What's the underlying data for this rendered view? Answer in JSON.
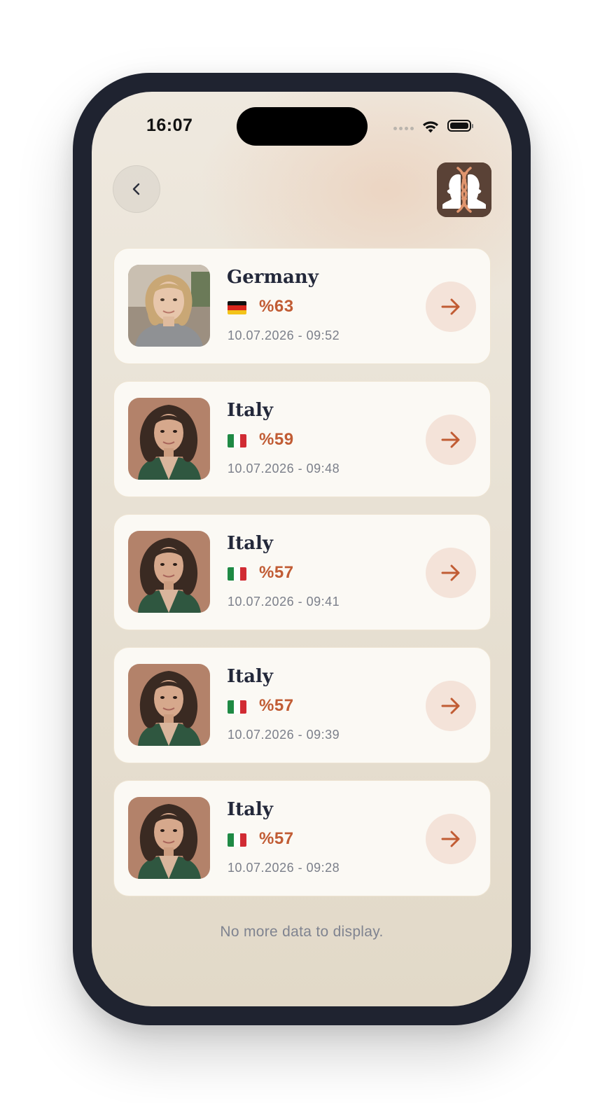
{
  "status_bar": {
    "time": "16:07",
    "signal_icon": "cellular-signal-icon",
    "wifi_icon": "wifi-icon",
    "battery_icon": "battery-icon"
  },
  "header": {
    "back_icon": "chevron-left-icon",
    "logo_icon": "dna-faces-logo-icon"
  },
  "results": [
    {
      "country": "Germany",
      "flag": "de",
      "score": "%63",
      "date": "10.07.2026 - 09:52",
      "photo": "blonde-woman-portrait"
    },
    {
      "country": "Italy",
      "flag": "it",
      "score": "%59",
      "date": "10.07.2026 - 09:48",
      "photo": "dark-haired-woman-portrait"
    },
    {
      "country": "Italy",
      "flag": "it",
      "score": "%57",
      "date": "10.07.2026 - 09:41",
      "photo": "dark-haired-woman-portrait"
    },
    {
      "country": "Italy",
      "flag": "it",
      "score": "%57",
      "date": "10.07.2026 - 09:39",
      "photo": "dark-haired-woman-portrait"
    },
    {
      "country": "Italy",
      "flag": "it",
      "score": "%57",
      "date": "10.07.2026 - 09:28",
      "photo": "dark-haired-woman-portrait"
    }
  ],
  "footer": {
    "end_message": "No more data to display."
  },
  "colors": {
    "accent": "#c15c34",
    "arrow_bg": "#f4e3d9",
    "card_bg": "#fbf9f4",
    "title_text": "#23283a",
    "muted_text": "#7b7f8a",
    "logo_bg": "#5a4236"
  }
}
